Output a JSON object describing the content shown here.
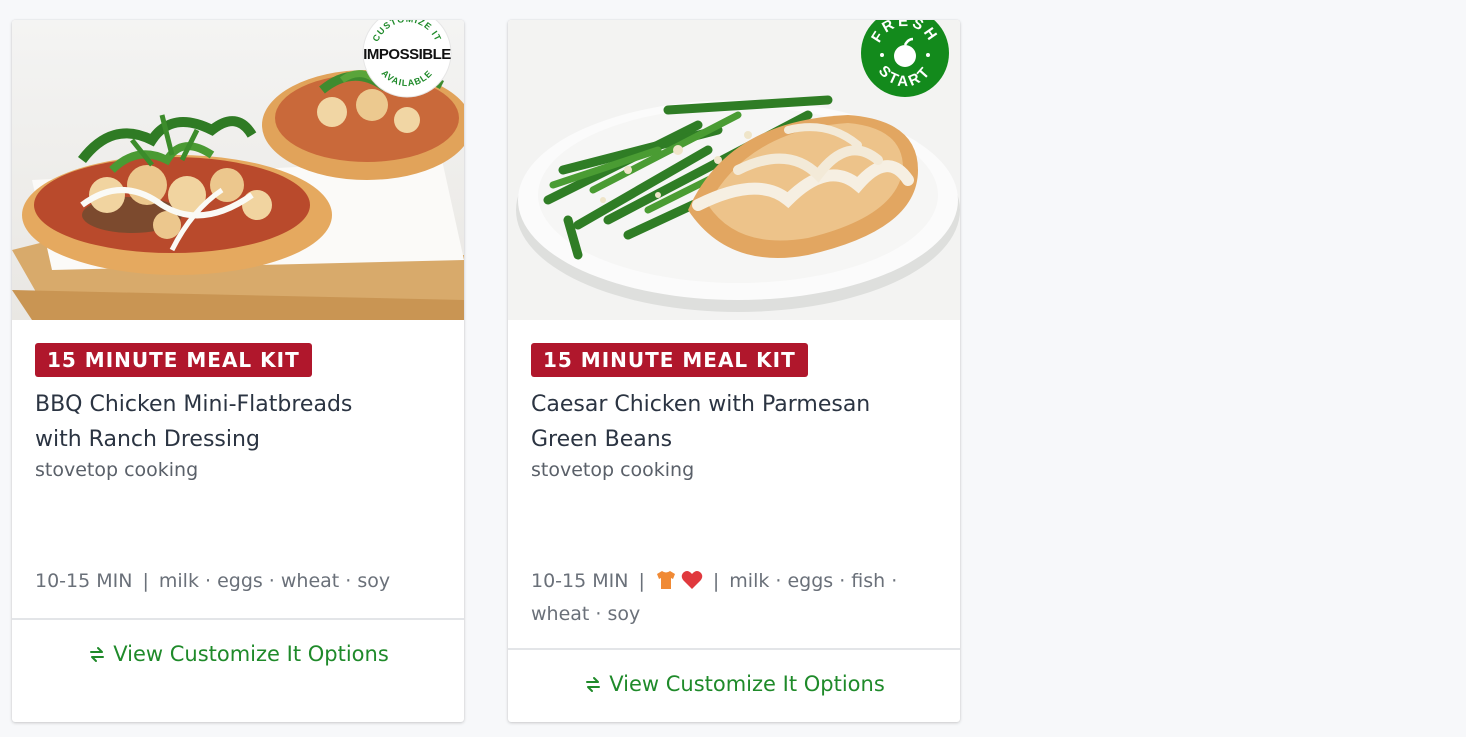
{
  "cards": [
    {
      "tag": "15 MINUTE MEAL KIT",
      "title_line1": "BBQ Chicken Mini-Flatbreads",
      "title_line2": "with Ranch Dressing",
      "subtitle": "stovetop cooking",
      "time": "10-15 MIN",
      "allergens": "milk · eggs · wheat · soy",
      "action": "View Customize It Options",
      "seal": {
        "top_text": "CUSTOMIZE IT",
        "brand": "IMPOSSIBLE",
        "bottom_text": "AVAILABLE"
      }
    },
    {
      "tag": "15 MINUTE MEAL KIT",
      "title_line1": "Caesar Chicken with Parmesan",
      "title_line2": "Green Beans",
      "subtitle": "stovetop cooking",
      "time": "10-15 MIN",
      "allergens_line1": "milk · eggs · fish ·",
      "allergens_line2": "wheat · soy",
      "action": "View Customize It Options",
      "seal": {
        "top_text": "FRESH",
        "bottom_text": "START"
      }
    }
  ],
  "colors": {
    "tag_bg": "#b0172c",
    "action": "#1f8a2a",
    "fresh_start": "#138a1c",
    "heart": "#e0393e",
    "chef": "#f08a35"
  }
}
